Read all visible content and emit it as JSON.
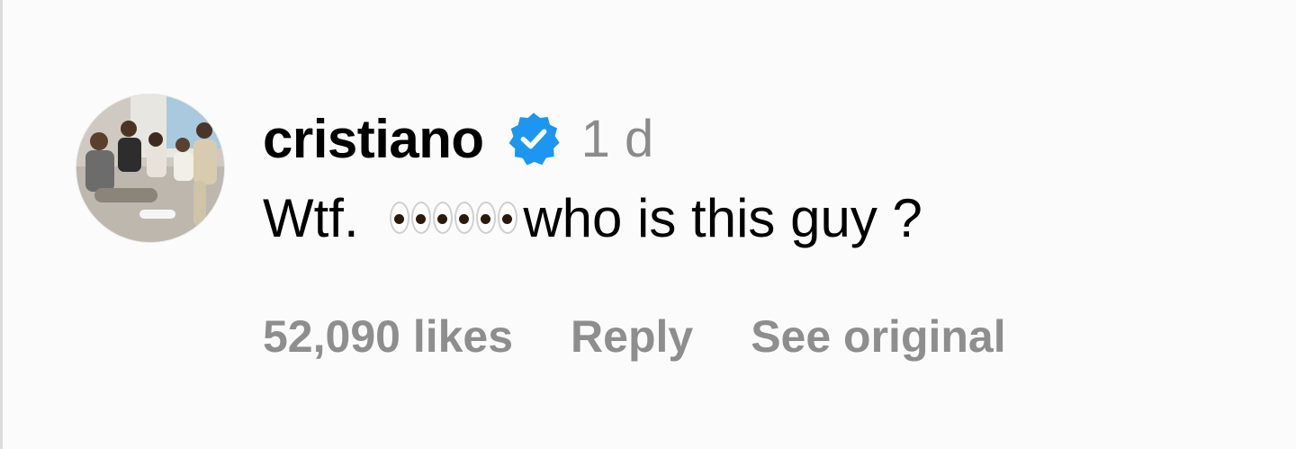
{
  "comment": {
    "username": "cristiano",
    "verified": true,
    "time": "1 d",
    "text_prefix": "Wtf. ",
    "eyes_emoji": "👀👀👀",
    "text_suffix": "who is this guy ?",
    "likes": "52,090 likes",
    "reply_label": "Reply",
    "see_original_label": "See original"
  },
  "colors": {
    "verified_blue": "#1c96f0",
    "meta_gray": "#8e8e8e",
    "background": "#fbfbfb"
  },
  "icons": {
    "verified": "verified-badge-icon",
    "avatar": "family-photo-avatar"
  }
}
